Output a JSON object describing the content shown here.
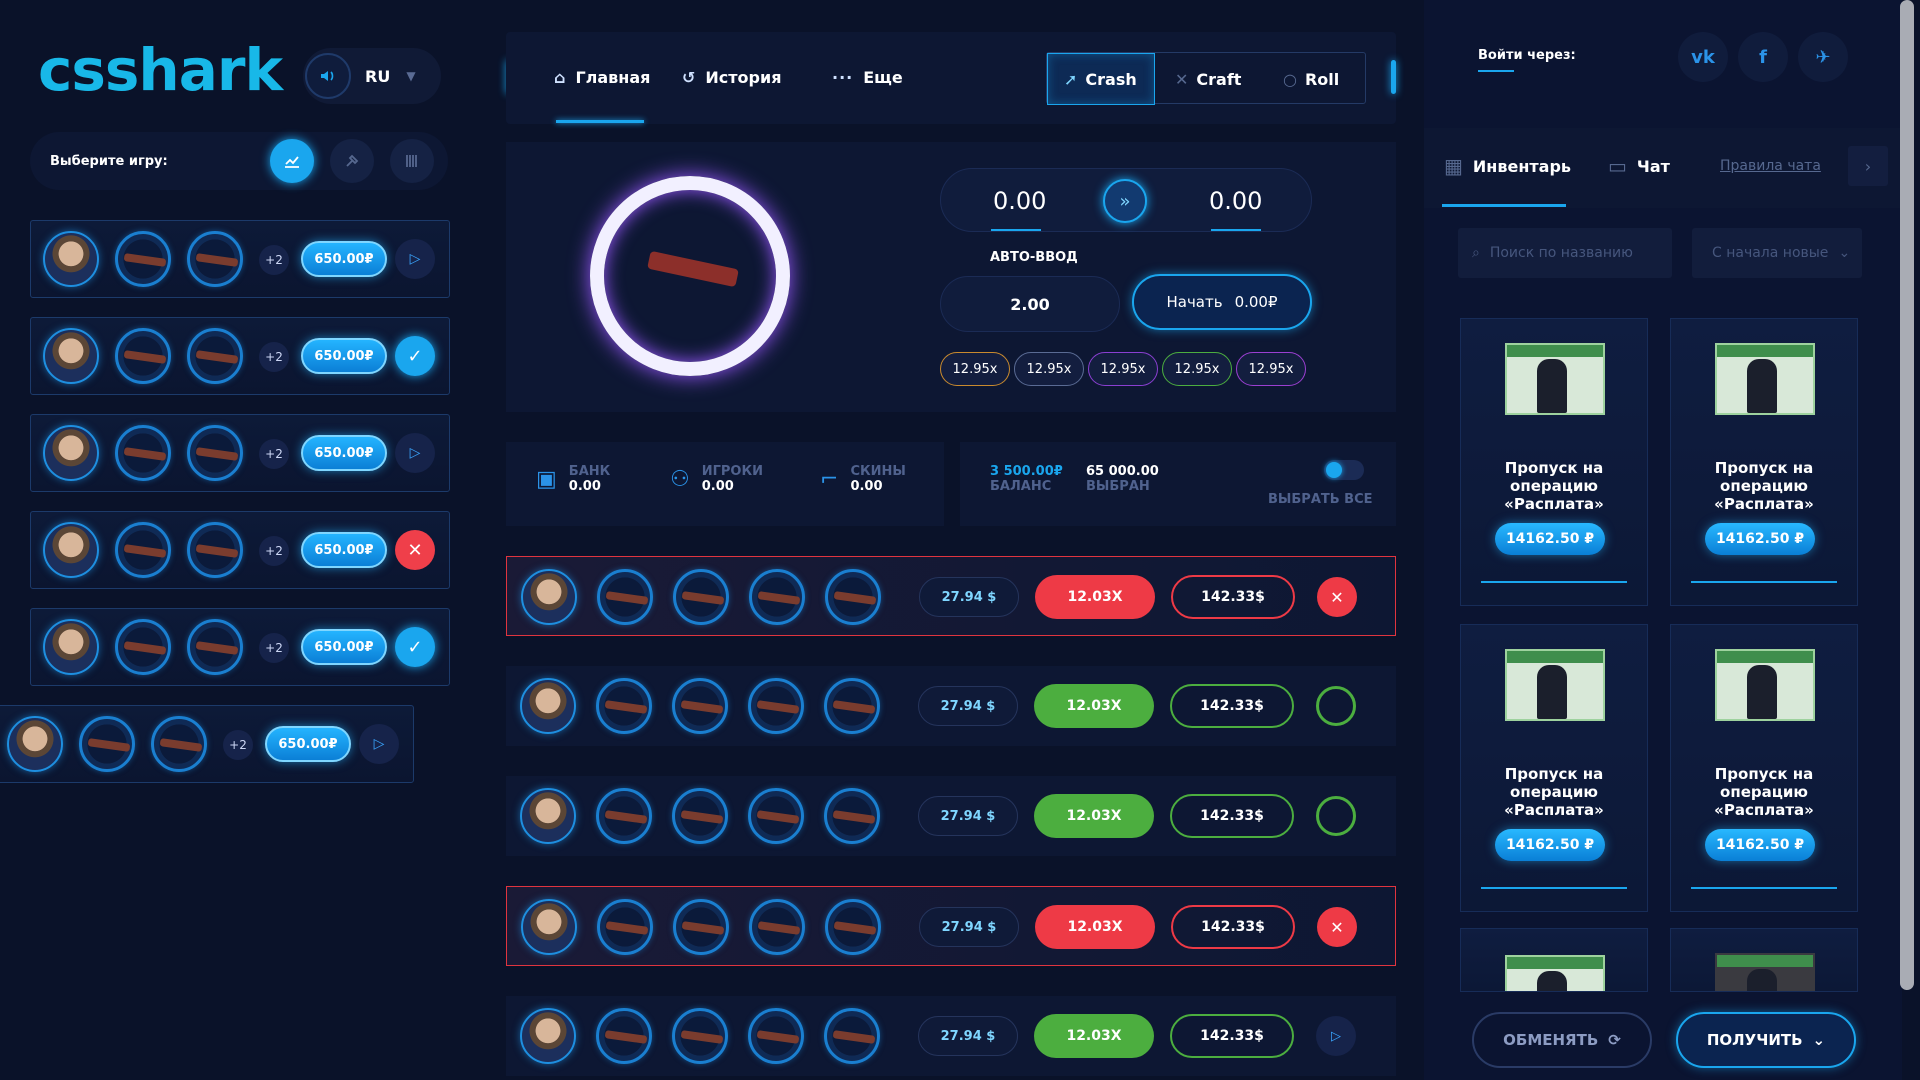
{
  "brand": {
    "logo": "csshark"
  },
  "lang": {
    "code": "RU"
  },
  "game_picker": {
    "label": "Выберите игру:"
  },
  "left_rows": [
    {
      "plus": "+2",
      "amount": "650.00₽",
      "status": "play"
    },
    {
      "plus": "+2",
      "amount": "650.00₽",
      "status": "ok"
    },
    {
      "plus": "+2",
      "amount": "650.00₽",
      "status": "play"
    },
    {
      "plus": "+2",
      "amount": "650.00₽",
      "status": "no"
    },
    {
      "plus": "+2",
      "amount": "650.00₽",
      "status": "ok"
    },
    {
      "plus": "+2",
      "amount": "650.00₽",
      "status": "play"
    }
  ],
  "nav": {
    "home": "Главная",
    "history": "История",
    "more": "Еще",
    "modes": [
      "Crash",
      "Craft",
      "Roll"
    ]
  },
  "crash": {
    "input_left": "0.00",
    "input_right": "0.00",
    "auto_label": "АВТО-ВВОД",
    "auto_value": "2.00",
    "start_label": "Начать",
    "start_amount": "0.00₽",
    "multipliers": [
      "12.95x",
      "12.95x",
      "12.95x",
      "12.95x",
      "12.95x"
    ],
    "multiplier_colors": [
      "#c98a2e",
      "#5a6b94",
      "#8a3fd1",
      "#4cae3f",
      "#9b3fd1"
    ]
  },
  "stats": {
    "bank_label": "БАНК",
    "bank_value": "0.00",
    "players_label": "ИГРОКИ",
    "players_value": "0.00",
    "skins_label": "СКИНЫ",
    "skins_value": "0.00",
    "balance_value": "3 500.00₽",
    "balance_label": "БАЛАНС",
    "selected_value": "65 000.00",
    "selected_label": "ВЫБРАН",
    "select_all": "ВЫБРАТЬ ВСЕ"
  },
  "game_rows": [
    {
      "usd": "27.94 $",
      "mult": "12.03X",
      "total": "142.33$",
      "result": "lose"
    },
    {
      "usd": "27.94 $",
      "mult": "12.03X",
      "total": "142.33$",
      "result": "win"
    },
    {
      "usd": "27.94 $",
      "mult": "12.03X",
      "total": "142.33$",
      "result": "win"
    },
    {
      "usd": "27.94 $",
      "mult": "12.03X",
      "total": "142.33$",
      "result": "lose"
    },
    {
      "usd": "27.94 $",
      "mult": "12.03X",
      "total": "142.33$",
      "result": "pending"
    }
  ],
  "right": {
    "login_label": "Войти через:",
    "social": [
      "vk",
      "f",
      "tw"
    ],
    "tab_inventory": "Инвентарь",
    "tab_chat": "Чат",
    "chat_rules": "Правила чата",
    "search_placeholder": "Поиск по названию",
    "sort_label": "С начала новые",
    "cards": [
      {
        "title": "Пропуск на операцию «Расплата»",
        "price": "14162.50 ₽"
      },
      {
        "title": "Пропуск на операцию «Расплата»",
        "price": "14162.50 ₽"
      },
      {
        "title": "Пропуск на операцию «Расплата»",
        "price": "14162.50 ₽"
      },
      {
        "title": "Пропуск на операцию «Расплата»",
        "price": "14162.50 ₽"
      }
    ],
    "swap_label": "ОБМЕНЯТЬ",
    "get_label": "ПОЛУЧИТЬ"
  },
  "colors": {
    "accent": "#1aa6ee",
    "lose": "#ee3a46",
    "win": "#4cae3f",
    "bg": "#0a1229"
  }
}
